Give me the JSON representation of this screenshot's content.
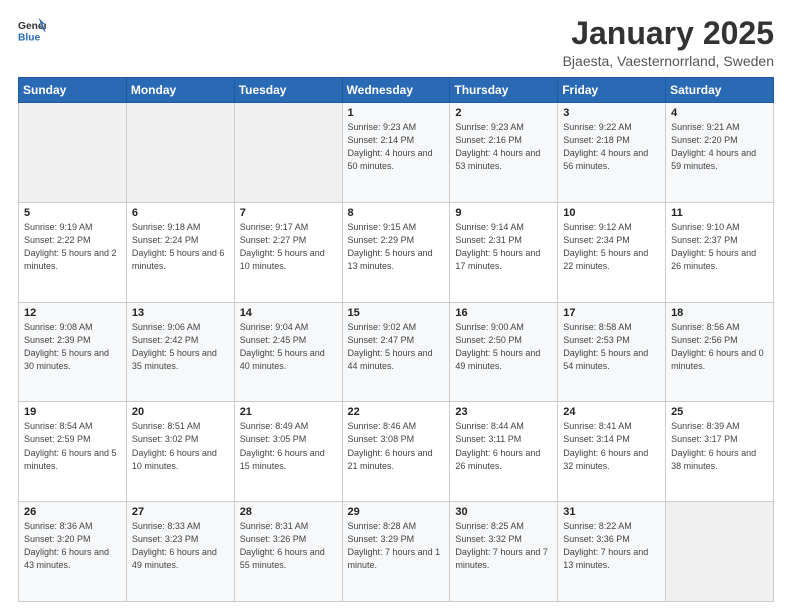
{
  "header": {
    "logo_general": "General",
    "logo_blue": "Blue",
    "month_year": "January 2025",
    "location": "Bjaesta, Vaesternorrland, Sweden"
  },
  "days_of_week": [
    "Sunday",
    "Monday",
    "Tuesday",
    "Wednesday",
    "Thursday",
    "Friday",
    "Saturday"
  ],
  "weeks": [
    [
      {
        "day": "",
        "sunrise": "",
        "sunset": "",
        "daylight": ""
      },
      {
        "day": "",
        "sunrise": "",
        "sunset": "",
        "daylight": ""
      },
      {
        "day": "",
        "sunrise": "",
        "sunset": "",
        "daylight": ""
      },
      {
        "day": "1",
        "sunrise": "Sunrise: 9:23 AM",
        "sunset": "Sunset: 2:14 PM",
        "daylight": "Daylight: 4 hours and 50 minutes."
      },
      {
        "day": "2",
        "sunrise": "Sunrise: 9:23 AM",
        "sunset": "Sunset: 2:16 PM",
        "daylight": "Daylight: 4 hours and 53 minutes."
      },
      {
        "day": "3",
        "sunrise": "Sunrise: 9:22 AM",
        "sunset": "Sunset: 2:18 PM",
        "daylight": "Daylight: 4 hours and 56 minutes."
      },
      {
        "day": "4",
        "sunrise": "Sunrise: 9:21 AM",
        "sunset": "Sunset: 2:20 PM",
        "daylight": "Daylight: 4 hours and 59 minutes."
      }
    ],
    [
      {
        "day": "5",
        "sunrise": "Sunrise: 9:19 AM",
        "sunset": "Sunset: 2:22 PM",
        "daylight": "Daylight: 5 hours and 2 minutes."
      },
      {
        "day": "6",
        "sunrise": "Sunrise: 9:18 AM",
        "sunset": "Sunset: 2:24 PM",
        "daylight": "Daylight: 5 hours and 6 minutes."
      },
      {
        "day": "7",
        "sunrise": "Sunrise: 9:17 AM",
        "sunset": "Sunset: 2:27 PM",
        "daylight": "Daylight: 5 hours and 10 minutes."
      },
      {
        "day": "8",
        "sunrise": "Sunrise: 9:15 AM",
        "sunset": "Sunset: 2:29 PM",
        "daylight": "Daylight: 5 hours and 13 minutes."
      },
      {
        "day": "9",
        "sunrise": "Sunrise: 9:14 AM",
        "sunset": "Sunset: 2:31 PM",
        "daylight": "Daylight: 5 hours and 17 minutes."
      },
      {
        "day": "10",
        "sunrise": "Sunrise: 9:12 AM",
        "sunset": "Sunset: 2:34 PM",
        "daylight": "Daylight: 5 hours and 22 minutes."
      },
      {
        "day": "11",
        "sunrise": "Sunrise: 9:10 AM",
        "sunset": "Sunset: 2:37 PM",
        "daylight": "Daylight: 5 hours and 26 minutes."
      }
    ],
    [
      {
        "day": "12",
        "sunrise": "Sunrise: 9:08 AM",
        "sunset": "Sunset: 2:39 PM",
        "daylight": "Daylight: 5 hours and 30 minutes."
      },
      {
        "day": "13",
        "sunrise": "Sunrise: 9:06 AM",
        "sunset": "Sunset: 2:42 PM",
        "daylight": "Daylight: 5 hours and 35 minutes."
      },
      {
        "day": "14",
        "sunrise": "Sunrise: 9:04 AM",
        "sunset": "Sunset: 2:45 PM",
        "daylight": "Daylight: 5 hours and 40 minutes."
      },
      {
        "day": "15",
        "sunrise": "Sunrise: 9:02 AM",
        "sunset": "Sunset: 2:47 PM",
        "daylight": "Daylight: 5 hours and 44 minutes."
      },
      {
        "day": "16",
        "sunrise": "Sunrise: 9:00 AM",
        "sunset": "Sunset: 2:50 PM",
        "daylight": "Daylight: 5 hours and 49 minutes."
      },
      {
        "day": "17",
        "sunrise": "Sunrise: 8:58 AM",
        "sunset": "Sunset: 2:53 PM",
        "daylight": "Daylight: 5 hours and 54 minutes."
      },
      {
        "day": "18",
        "sunrise": "Sunrise: 8:56 AM",
        "sunset": "Sunset: 2:56 PM",
        "daylight": "Daylight: 6 hours and 0 minutes."
      }
    ],
    [
      {
        "day": "19",
        "sunrise": "Sunrise: 8:54 AM",
        "sunset": "Sunset: 2:59 PM",
        "daylight": "Daylight: 6 hours and 5 minutes."
      },
      {
        "day": "20",
        "sunrise": "Sunrise: 8:51 AM",
        "sunset": "Sunset: 3:02 PM",
        "daylight": "Daylight: 6 hours and 10 minutes."
      },
      {
        "day": "21",
        "sunrise": "Sunrise: 8:49 AM",
        "sunset": "Sunset: 3:05 PM",
        "daylight": "Daylight: 6 hours and 15 minutes."
      },
      {
        "day": "22",
        "sunrise": "Sunrise: 8:46 AM",
        "sunset": "Sunset: 3:08 PM",
        "daylight": "Daylight: 6 hours and 21 minutes."
      },
      {
        "day": "23",
        "sunrise": "Sunrise: 8:44 AM",
        "sunset": "Sunset: 3:11 PM",
        "daylight": "Daylight: 6 hours and 26 minutes."
      },
      {
        "day": "24",
        "sunrise": "Sunrise: 8:41 AM",
        "sunset": "Sunset: 3:14 PM",
        "daylight": "Daylight: 6 hours and 32 minutes."
      },
      {
        "day": "25",
        "sunrise": "Sunrise: 8:39 AM",
        "sunset": "Sunset: 3:17 PM",
        "daylight": "Daylight: 6 hours and 38 minutes."
      }
    ],
    [
      {
        "day": "26",
        "sunrise": "Sunrise: 8:36 AM",
        "sunset": "Sunset: 3:20 PM",
        "daylight": "Daylight: 6 hours and 43 minutes."
      },
      {
        "day": "27",
        "sunrise": "Sunrise: 8:33 AM",
        "sunset": "Sunset: 3:23 PM",
        "daylight": "Daylight: 6 hours and 49 minutes."
      },
      {
        "day": "28",
        "sunrise": "Sunrise: 8:31 AM",
        "sunset": "Sunset: 3:26 PM",
        "daylight": "Daylight: 6 hours and 55 minutes."
      },
      {
        "day": "29",
        "sunrise": "Sunrise: 8:28 AM",
        "sunset": "Sunset: 3:29 PM",
        "daylight": "Daylight: 7 hours and 1 minute."
      },
      {
        "day": "30",
        "sunrise": "Sunrise: 8:25 AM",
        "sunset": "Sunset: 3:32 PM",
        "daylight": "Daylight: 7 hours and 7 minutes."
      },
      {
        "day": "31",
        "sunrise": "Sunrise: 8:22 AM",
        "sunset": "Sunset: 3:36 PM",
        "daylight": "Daylight: 7 hours and 13 minutes."
      },
      {
        "day": "",
        "sunrise": "",
        "sunset": "",
        "daylight": ""
      }
    ]
  ]
}
